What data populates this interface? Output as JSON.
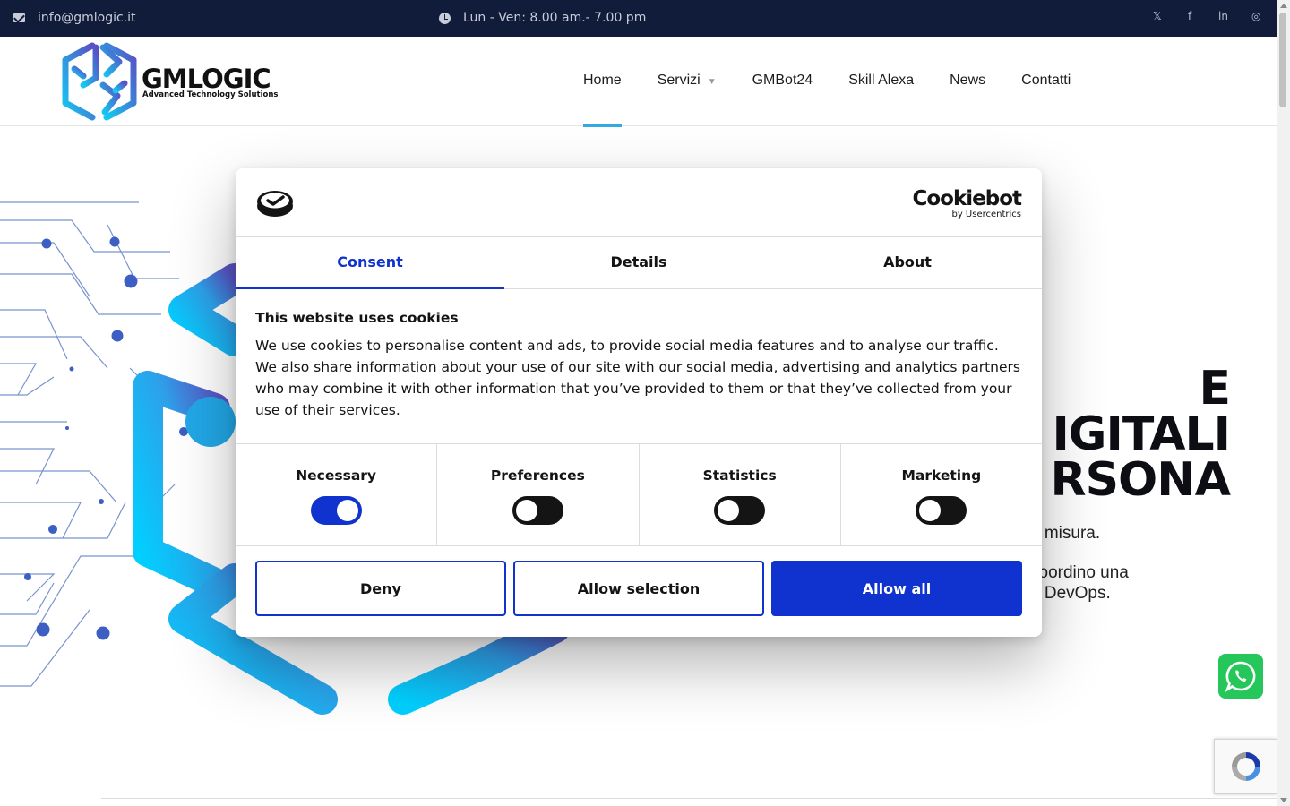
{
  "topbar": {
    "email": "info@gmlogic.it",
    "hours": "Lun - Ven: 8.00 am.- 7.00 pm",
    "social": [
      {
        "icon": "x-twitter-icon",
        "glyph": "𝕏"
      },
      {
        "icon": "facebook-icon",
        "glyph": "f"
      },
      {
        "icon": "linkedin-icon",
        "glyph": "in"
      },
      {
        "icon": "instagram-icon",
        "glyph": "◎"
      }
    ]
  },
  "logo": {
    "name": "GMLOGIC",
    "tagline": "Advanced Technology Solutions"
  },
  "nav": {
    "items": [
      "Home",
      "Servizi",
      "GMBot24",
      "Skill Alexa",
      "News",
      "Contatti"
    ],
    "caret": "▼",
    "active": "Home"
  },
  "hero": {
    "title_lines": [
      "E",
      "IGITALI",
      "RSONA"
    ],
    "p1": "u misura.",
    "p2_line1": "coordino una",
    "p2_line2": "e DevOps."
  },
  "cookie": {
    "brand": "Cookiebot",
    "brand_sub": "by Usercentrics",
    "tabs": [
      "Consent",
      "Details",
      "About"
    ],
    "heading": "This website uses cookies",
    "body": "We use cookies to personalise content and ads, to provide social media features and to analyse our traffic. We also share information about your use of our site with our social media, advertising and analytics partners who may combine it with other information that you’ve provided to them or that they’ve collected from your use of their services.",
    "categories": [
      {
        "label": "Necessary",
        "on": true
      },
      {
        "label": "Preferences",
        "on": false
      },
      {
        "label": "Statistics",
        "on": false
      },
      {
        "label": "Marketing",
        "on": false
      }
    ],
    "buttons": {
      "deny": "Deny",
      "selection": "Allow selection",
      "all": "Allow all"
    }
  },
  "colors": {
    "topbar": "#111b3a",
    "accent": "#1032cf",
    "nav_underline": "#34a8e0",
    "whatsapp": "#25c75a"
  }
}
